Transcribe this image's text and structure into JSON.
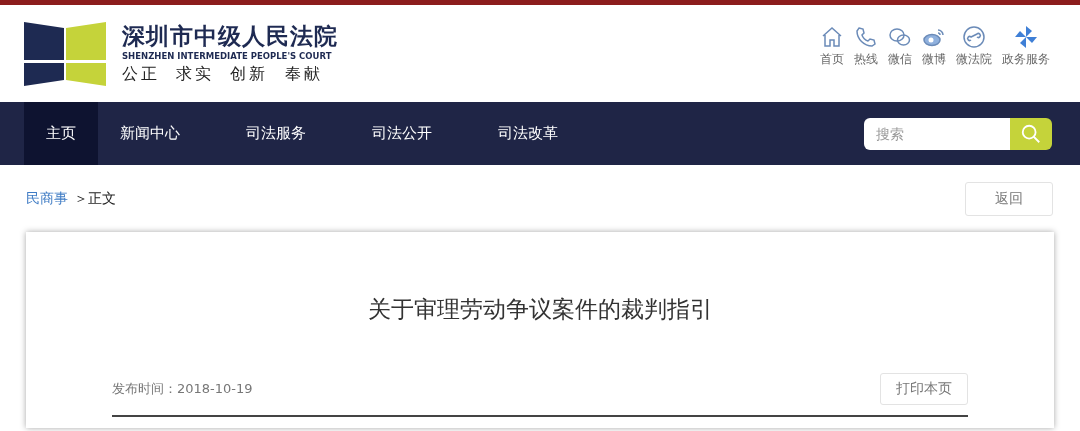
{
  "logo": {
    "title": "深圳市中级人民法院",
    "subtitle": "SHENZHEN INTERMEDIATE PEOPLE'S COURT",
    "slogan": "公正  求实  创新  奉献"
  },
  "quick_links": [
    {
      "kind": "home",
      "label": "首页"
    },
    {
      "kind": "phone",
      "label": "热线"
    },
    {
      "kind": "wechat",
      "label": "微信"
    },
    {
      "kind": "weibo",
      "label": "微博"
    },
    {
      "kind": "miniapp",
      "label": "微法院"
    },
    {
      "kind": "pinwheel",
      "label": "政务服务"
    }
  ],
  "nav": [
    {
      "label": "主页",
      "selected": true
    },
    {
      "label": "新闻中心",
      "selected": false
    },
    {
      "label": "司法服务",
      "selected": false
    },
    {
      "label": "司法公开",
      "selected": false
    },
    {
      "label": "司法改革",
      "selected": false
    }
  ],
  "search": {
    "placeholder": "搜索"
  },
  "breadcrumb": {
    "link": "民商事",
    "current": "＞正文"
  },
  "back_button": "返回",
  "article": {
    "title": "关于审理劳动争议案件的裁判指引",
    "published": "发布时间：2018-10-19",
    "print_button": "打印本页"
  }
}
